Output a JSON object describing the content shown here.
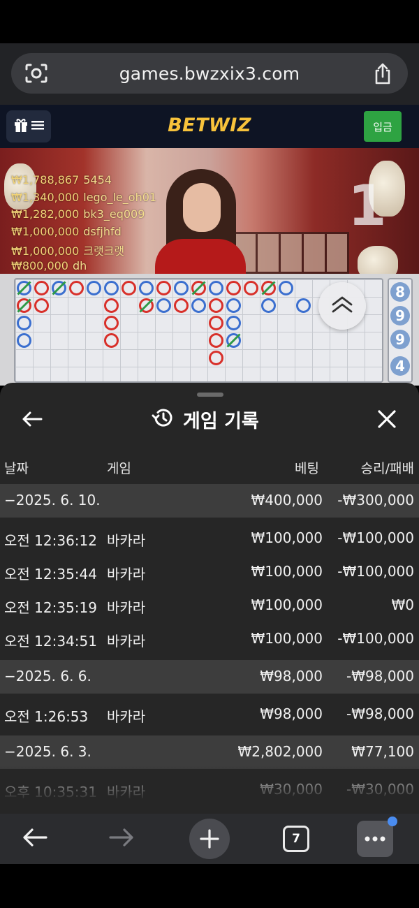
{
  "browser": {
    "url": "games.bwzxix3.com",
    "tab_count": "7"
  },
  "site": {
    "brand": "BETWIZ",
    "deposit_label": "입금"
  },
  "live": {
    "round_number": "1",
    "bets": [
      {
        "amount": "₩1,788,867",
        "name": "5454"
      },
      {
        "amount": "₩1,340,000",
        "name": "lego_le_oh01"
      },
      {
        "amount": "₩1,282,000",
        "name": "bk3_eq009"
      },
      {
        "amount": "₩1,000,000",
        "name": "dsfjhfd"
      },
      {
        "amount": "₩1,000,000",
        "name": "크랫크랫"
      },
      {
        "amount": "₩800,000",
        "name": "dh"
      }
    ],
    "side_numbers": [
      "8",
      "9",
      "9",
      "4"
    ]
  },
  "history": {
    "title": "게임 기록",
    "columns": {
      "date": "날짜",
      "game": "게임",
      "bet": "베팅",
      "result": "승리/패배"
    },
    "groups": [
      {
        "date": "−2025. 6. 10.",
        "bet": "₩400,000",
        "result": "-₩300,000",
        "rows": [
          {
            "time": "오전 12:36:12",
            "game": "바카라",
            "bet": "₩100,000",
            "result": "-₩100,000"
          },
          {
            "time": "오전 12:35:44",
            "game": "바카라",
            "bet": "₩100,000",
            "result": "-₩100,000"
          },
          {
            "time": "오전 12:35:19",
            "game": "바카라",
            "bet": "₩100,000",
            "result": "₩0"
          },
          {
            "time": "오전 12:34:51",
            "game": "바카라",
            "bet": "₩100,000",
            "result": "-₩100,000"
          }
        ]
      },
      {
        "date": "−2025. 6. 6.",
        "bet": "₩98,000",
        "result": "-₩98,000",
        "rows": [
          {
            "time": "오전 1:26:53",
            "game": "바카라",
            "bet": "₩98,000",
            "result": "-₩98,000"
          }
        ]
      },
      {
        "date": "−2025. 6. 3.",
        "bet": "₩2,802,000",
        "result": "₩77,100",
        "rows": [
          {
            "time": "오후 10:35:31",
            "game": "바카라",
            "bet": "₩30,000",
            "result": "-₩30,000"
          }
        ]
      }
    ]
  },
  "icons": {
    "lens": "lens-icon",
    "share": "share-icon",
    "gift": "gift-icon",
    "menu": "menu-icon",
    "history": "history-icon",
    "back": "arrow-left-icon",
    "close": "close-icon",
    "chevron_up": "double-chevron-up-icon",
    "forward": "arrow-right-icon",
    "plus": "plus-icon",
    "tabs": "tabs-icon",
    "more": "more-icon"
  },
  "colors": {
    "player_blue": "#3b6fcf",
    "banker_red": "#d8302a",
    "tie_green": "#2e9a46",
    "brand_gold": "#f7c23b",
    "deposit_green": "#2ea342"
  }
}
